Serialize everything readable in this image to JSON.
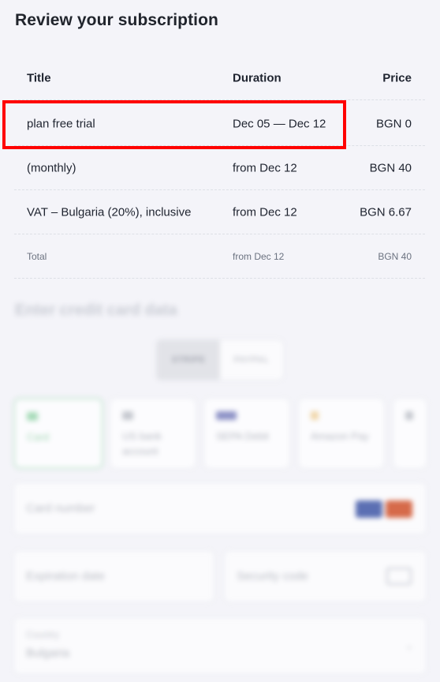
{
  "page_title": "Review your subscription",
  "table": {
    "headers": {
      "title": "Title",
      "duration": "Duration",
      "price": "Price"
    },
    "rows": [
      {
        "title": "plan free trial",
        "duration": "Dec 05 — Dec 12",
        "price": "BGN 0"
      },
      {
        "title": "(monthly)",
        "duration": "from Dec 12",
        "price": "BGN 40"
      },
      {
        "title": "VAT – Bulgaria (20%), inclusive",
        "duration": "from Dec 12",
        "price": "BGN 6.67"
      }
    ],
    "total": {
      "title": "Total",
      "duration": "from Dec 12",
      "price": "BGN 40"
    }
  },
  "payment": {
    "heading": "Enter credit card data",
    "providers": {
      "stripe": "STRIPE",
      "paypal": "PAYPAL",
      "selected": "STRIPE"
    },
    "methods": [
      {
        "label": "Card",
        "icon": "credit-card-icon",
        "selected": true
      },
      {
        "label": "US bank account",
        "icon": "bank-icon",
        "selected": false
      },
      {
        "label": "SEPA Debit",
        "icon": "sepa-icon",
        "selected": false
      },
      {
        "label": "Amazon Pay",
        "icon": "amazon-pay-icon",
        "selected": false
      }
    ],
    "fields": {
      "card_number": "Card number",
      "expiration": "Expiration date",
      "security_code": "Security code",
      "country_label": "Country",
      "country_value": "Bulgaria"
    }
  },
  "colors": {
    "highlight": "#ff0000",
    "active_method": "#9fd4b1",
    "background": "#f4f4f9"
  }
}
